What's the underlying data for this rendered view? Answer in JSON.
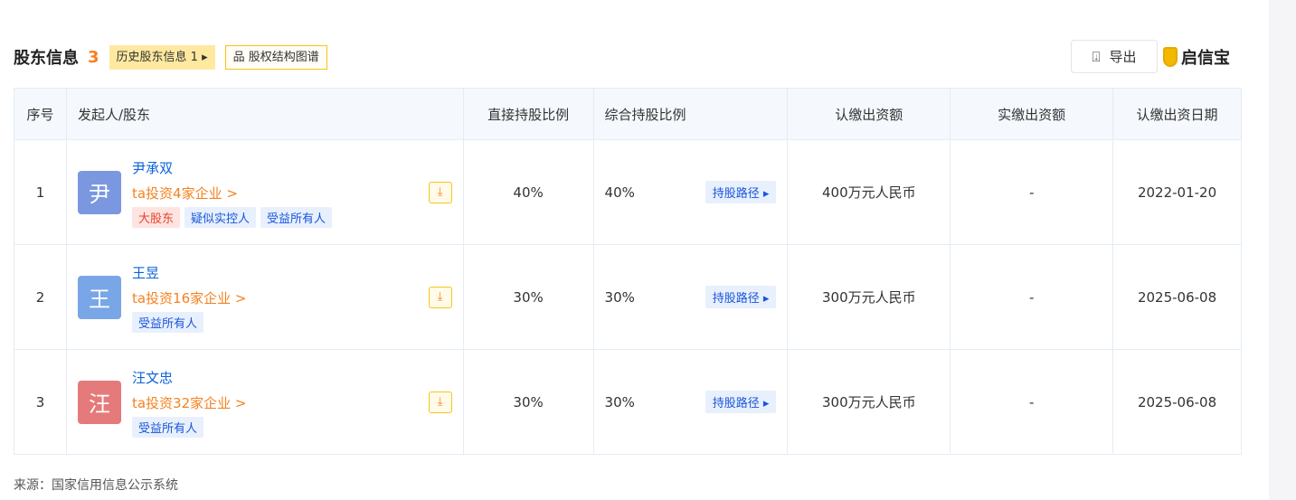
{
  "header": {
    "title": "股东信息",
    "count": "3",
    "history_label": "历史股东信息 1 ▸",
    "graph_label": "股权结构图谱",
    "export_label": "导出",
    "logo_text": "启信宝"
  },
  "columns": [
    "序号",
    "发起人/股东",
    "直接持股比例",
    "综合持股比例",
    "认缴出资额",
    "实缴出资额",
    "认缴出资日期"
  ],
  "rows": [
    {
      "index": "1",
      "avatar": "尹",
      "avatar_color": "#7b97e0",
      "name": "尹承双",
      "investments": "ta投资4家企业 >",
      "tags": [
        "大股东",
        "疑似实控人",
        "受益所有人"
      ],
      "direct": "40%",
      "combined": "40%",
      "path_label": "持股路径 ▸",
      "subscribed": "400万元人民币",
      "paid": "-",
      "date": "2022-01-20"
    },
    {
      "index": "2",
      "avatar": "王",
      "avatar_color": "#79a6e6",
      "name": "王昱",
      "investments": "ta投资16家企业 >",
      "tags": [
        "受益所有人"
      ],
      "direct": "30%",
      "combined": "30%",
      "path_label": "持股路径 ▸",
      "subscribed": "300万元人民币",
      "paid": "-",
      "date": "2025-06-08"
    },
    {
      "index": "3",
      "avatar": "汪",
      "avatar_color": "#e57a7a",
      "name": "汪文忠",
      "investments": "ta投资32家企业 >",
      "tags": [
        "受益所有人"
      ],
      "direct": "30%",
      "combined": "30%",
      "path_label": "持股路径 ▸",
      "subscribed": "300万元人民币",
      "paid": "-",
      "date": "2025-06-08"
    }
  ],
  "source": "来源：国家信用信息公示系统"
}
